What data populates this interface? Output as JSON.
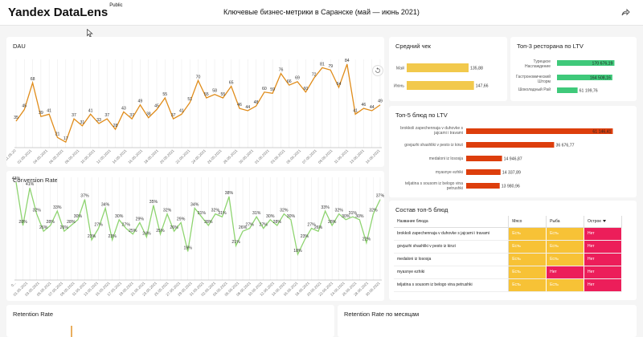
{
  "header": {
    "logo": "Yandex DataLens",
    "badge": "Public",
    "title": "Ключевые бизнес-метрики в Саранске (май — июнь 2021)"
  },
  "colors": {
    "dau_line": "#e08c1a",
    "conversion_line": "#8ed470",
    "check_bar": "#f2c94c",
    "ltv_restaurant_bar": "#3fc97a",
    "ltv_dish_bar": "#dd3e0c",
    "yes": "#f7c236",
    "no": "#ec1e5a"
  },
  "panels": {
    "dau": {
      "title": "DAU"
    },
    "conversion": {
      "title": "Conversion Rate"
    },
    "check": {
      "title": "Средний чек"
    },
    "top_restaurants": {
      "title": "Топ-3 ресторана по LTV"
    },
    "top_dishes": {
      "title": "Топ-5 блюд по LTV"
    },
    "composition": {
      "title": "Состав топ-5 блюд"
    },
    "retention": {
      "title": "Retention Rate"
    },
    "retention_month": {
      "title": "Retention Rate по месяцам"
    }
  },
  "chart_data": [
    {
      "type": "line",
      "title": "DAU",
      "x": [
        "11.05.20",
        "02.05.2021",
        "03.05.2021",
        "04.05.2021",
        "05.05.2021",
        "06.05.2021",
        "07.05.2021",
        "08.05.2021",
        "09.05.2021",
        "10.05.2021",
        "11.05.2021",
        "12.05.2021",
        "13.05.2021",
        "14.05.2021",
        "15.05.2021",
        "16.05.2021",
        "17.05.2021",
        "18.05.2021",
        "19.05.2021",
        "20.05.2021",
        "21.05.2021",
        "22.05.2021",
        "23.05.2021",
        "24.05.2021",
        "25.05.2021",
        "26.05.2021",
        "27.05.2021",
        "28.05.2021",
        "29.05.2021",
        "30.05.2021",
        "31.05.2021",
        "01.06.2021",
        "02.06.2021",
        "03.06.2021",
        "04.06.2021",
        "05.06.2021",
        "06.06.2021",
        "07.06.2021",
        "08.06.2021",
        "09.06.2021",
        "10.06.2021",
        "11.06.2021",
        "12.06.2021",
        "13.06.2021",
        "14.06.2021"
      ],
      "x_tick_labels": [
        "11.05.20",
        "02.05.2021",
        "04.05.2021",
        "06.05.2021",
        "08.05.2021",
        "10.05.2021",
        "12.05.2021",
        "14.05.2021",
        "16.05.2021",
        "18.05.2021",
        "20.05.2021",
        "22.05.2021",
        "24.05.2021",
        "26.05.2021",
        "28.05.2021",
        "30.05.2021",
        "01.06.2021",
        "03.06.2021",
        "05.06.2021",
        "07.06.2021",
        "09.06.2021",
        "11.06.2021",
        "13.06.2021",
        "14.06.2021"
      ],
      "values": [
        35,
        45,
        68,
        39,
        41,
        21,
        17,
        37,
        31,
        41,
        33,
        37,
        28,
        43,
        37,
        49,
        38,
        45,
        55,
        37,
        41,
        51,
        70,
        55,
        58,
        55,
        65,
        46,
        44,
        48,
        60,
        59,
        76,
        66,
        69,
        60,
        72,
        81,
        79,
        64,
        84,
        41,
        46,
        44,
        49
      ]
    },
    {
      "type": "line",
      "title": "Conversion Rate",
      "x": [
        "0...",
        "01.05.2021",
        "02.05.2021",
        "03.05.2021",
        "04.05.2021",
        "05.05.2021",
        "06.05.2021",
        "07.05.2021",
        "08.05.2021",
        "09.05.2021",
        "10.05.2021",
        "11.05.2021",
        "12.05.2021",
        "13.05.2021",
        "14.05.2021",
        "15.05.2021",
        "16.05.2021",
        "17.05.2021",
        "18.05.2021",
        "19.05.2021",
        "20.05.2021",
        "21.05.2021",
        "22.05.2021",
        "23.05.2021",
        "24.05.2021",
        "25.05.2021",
        "26.05.2021",
        "27.05.2021",
        "28.05.2021",
        "29.05.2021",
        "30.05.2021",
        "31.05.2021",
        "01.06.2021",
        "02.06.2021",
        "03.06.2021",
        "04.06.2021",
        "05.06.2021",
        "06.06.2021",
        "07.06.2021",
        "08.06.2021",
        "09.06.2021",
        "10.06.2021",
        "11.06.2021",
        "12.06.2021",
        "13.06.2021",
        "14.06.2021",
        "15.06.2021",
        "16.06.2021",
        "17.06.2021",
        "18.06.2021",
        "19.06.2021",
        "20.06.2021",
        "21.06.2021",
        "22.06.2021",
        "23.06.2021",
        "24.06.2021",
        "25.06.2021",
        "26.06.2021",
        "27.06.2021",
        "28.06.2021",
        "29.06.2021",
        "30.06.2021"
      ],
      "x_tick_labels": [
        "0...",
        "01.05.2021",
        "03.05.2021",
        "05.05.2021",
        "07.05.2021",
        "09.05.2021",
        "11.05.2021",
        "13.05.2021",
        "15.05.2021",
        "17.05.2021",
        "19.05.2021",
        "21.05.2021",
        "23.05.2021",
        "25.05.2021",
        "27.05.2021",
        "29.05.2021",
        "31.05.2021",
        "02.06.2021",
        "04.06.2021",
        "06.06.2021",
        "08.06.2021",
        "10.06.2021",
        "12.06.2021",
        "14.06.2021",
        "16.06.2021",
        "18.06.2021",
        "20.06.2021",
        "22.06.2021",
        "24.06.2021",
        "26.06.2021",
        "28.06.2021",
        "30.06.2021"
      ],
      "values": [
        43,
        28,
        41,
        32,
        26,
        28,
        33,
        26,
        28,
        30,
        37,
        23,
        27,
        34,
        23,
        30,
        27,
        25,
        29,
        24,
        35,
        25,
        32,
        26,
        29,
        19,
        34,
        31,
        28,
        32,
        31,
        38,
        21,
        26,
        27,
        31,
        27,
        30,
        28,
        32,
        30,
        18,
        23,
        27,
        26,
        33,
        28,
        32,
        30,
        31,
        30,
        22,
        32,
        37
      ],
      "value_labels": [
        "43%",
        "28%",
        "41%",
        "32%",
        "26%",
        "28%",
        "33%",
        "26%",
        "28%",
        "30%",
        "37%",
        "23%",
        "27%",
        "34%",
        "23%",
        "30%",
        "27%",
        "25%",
        "29%",
        "24%",
        "35%",
        "25%",
        "32%",
        "26%",
        "29%",
        "19%",
        "34%",
        "31%",
        "28%",
        "32%",
        "31%",
        "38%",
        "21%",
        "26%",
        "27%",
        "31%",
        "27%",
        "30%",
        "28%",
        "32%",
        "30%",
        "18%",
        "23%",
        "27%",
        "26%",
        "33%",
        "28%",
        "32%",
        "30%",
        "31%",
        "30%",
        "22%",
        "32%",
        "37%"
      ]
    },
    {
      "type": "bar",
      "title": "Средний чек",
      "categories": [
        "Май",
        "Июнь"
      ],
      "values": [
        135.88,
        147.66
      ],
      "value_labels": [
        "135,88",
        "147,66"
      ]
    },
    {
      "type": "bar",
      "title": "Топ-3 ресторана по LTV",
      "categories": [
        "Турецкое Наслаждение",
        "Гастрономический Шторм",
        "Шоколадный Рай"
      ],
      "values": [
        170676.19,
        164508.16,
        61199.76
      ],
      "value_labels": [
        "170 676,19",
        "164 508,16",
        "61 199,76"
      ]
    },
    {
      "type": "bar",
      "title": "Топ-5 блюд по LTV",
      "categories": [
        "brokkoli zapechennaja v duhovke s jajcami i travami",
        "govjazhi shashliki v pesto iz kinzi",
        "medaloni iz lososja",
        "myasnye ezhiki",
        "teljatina s sousom iz belogo vina petrushki"
      ],
      "values": [
        61146.41,
        36676.77,
        14946.87,
        14337.89,
        13980.96
      ],
      "value_labels": [
        "61 146,41",
        "36 676,77",
        "14 946,87",
        "14 337,89",
        "13 980,96"
      ]
    },
    {
      "type": "table",
      "title": "Состав топ-5 блюд",
      "columns": [
        "Название блюда",
        "Мясо",
        "Рыба",
        "Острое"
      ],
      "rows": [
        [
          "brokkoli zapechennaja v duhovke s jajcami i travami",
          "Есть",
          "Есть",
          "Нет"
        ],
        [
          "govjazhi shashliki v pesto iz kinzi",
          "Есть",
          "Есть",
          "Нет"
        ],
        [
          "medaloni iz lososja",
          "Есть",
          "Есть",
          "Нет"
        ],
        [
          "myasnye ezhiki",
          "Есть",
          "Нет",
          "Нет"
        ],
        [
          "teljatina s sousom iz belogo vina petrushki",
          "Есть",
          "Есть",
          "Нет"
        ]
      ]
    }
  ]
}
